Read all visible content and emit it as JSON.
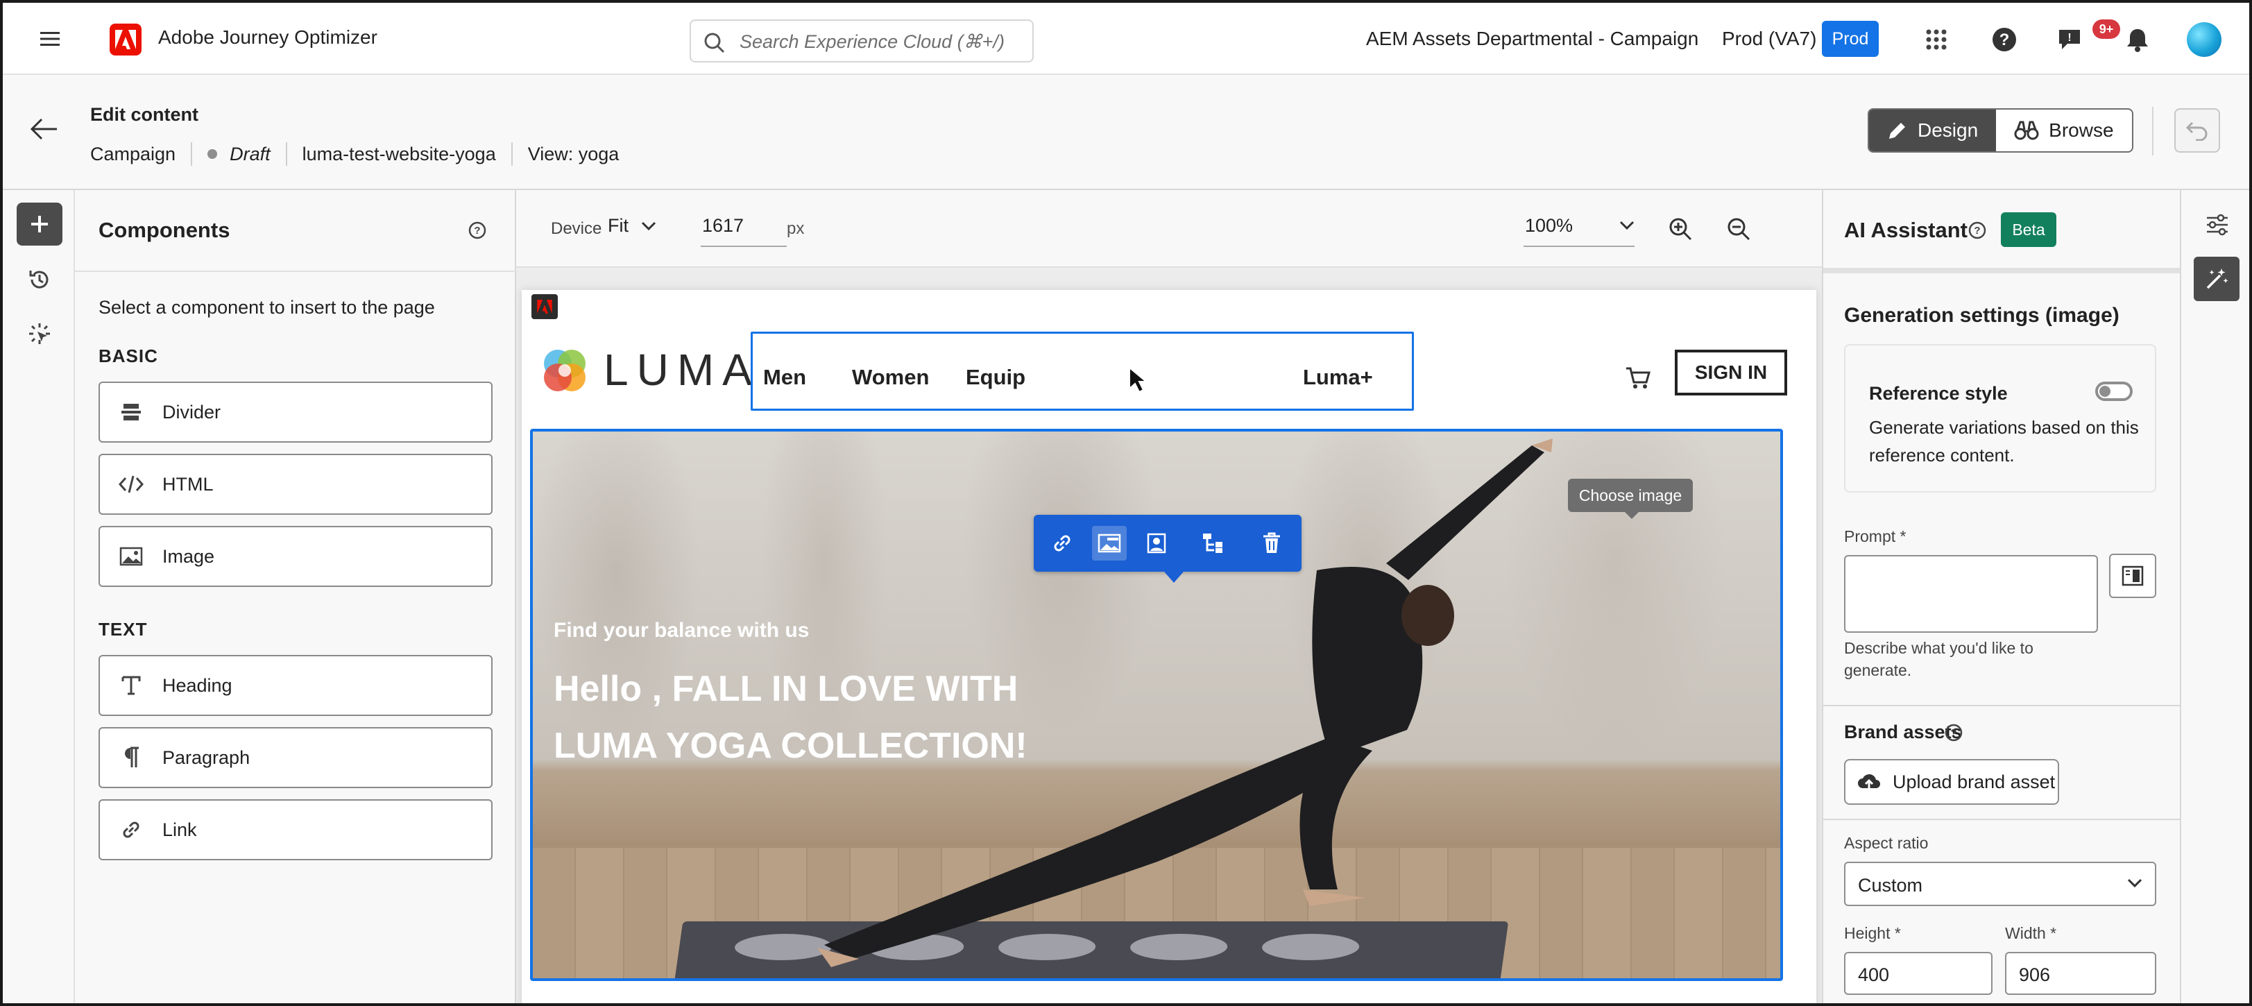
{
  "topbar": {
    "app_name": "Adobe Journey Optimizer",
    "search_placeholder": "Search Experience Cloud (⌘+/)",
    "org_name": "AEM Assets Departmental - Campaign",
    "env_label": "Prod (VA7)",
    "env_badge": "Prod",
    "notification_count": "9+"
  },
  "subheader": {
    "title": "Edit content",
    "breadcrumb": {
      "campaign": "Campaign",
      "status": "Draft",
      "name": "luma-test-website-yoga",
      "view": "View: yoga"
    },
    "mode_design": "Design",
    "mode_browse": "Browse"
  },
  "components": {
    "title": "Components",
    "description": "Select a component to insert to the page",
    "basic_label": "BASIC",
    "basic_items": [
      "Divider",
      "HTML",
      "Image"
    ],
    "text_label": "TEXT",
    "text_items": [
      "Heading",
      "Paragraph",
      "Link"
    ]
  },
  "canvas": {
    "device_label": "Device",
    "device_value": "Fit",
    "width_value": "1617",
    "width_unit": "px",
    "zoom_value": "100%"
  },
  "site": {
    "logo_text": "LUMA",
    "nav": [
      "Men",
      "Women",
      "Equip",
      "Luma+"
    ],
    "signin": "SIGN IN",
    "tooltip": "Choose image",
    "hero_subtitle": "Find your balance with us",
    "hero_title": "Hello , FALL IN LOVE WITH LUMA YOGA COLLECTION!"
  },
  "ai_assistant": {
    "title": "AI Assistant",
    "badge": "Beta",
    "generation_title": "Generation settings (image)",
    "reference_title": "Reference style",
    "reference_desc": "Generate variations based on this reference content.",
    "reference_enabled": false,
    "prompt_label": "Prompt *",
    "prompt_value": "",
    "prompt_help": "Describe what you'd like to generate.",
    "brand_title": "Brand assets",
    "upload_label": "Upload brand asset",
    "aspect_label": "Aspect ratio",
    "aspect_value": "Custom",
    "height_label": "Height *",
    "height_value": "400",
    "width_label": "Width *",
    "width_value": "906"
  },
  "colors": {
    "accent": "#1473e6",
    "selection_toolbar": "#1a5fd3",
    "beta": "#12805c",
    "adobe_red": "#eb1000"
  }
}
